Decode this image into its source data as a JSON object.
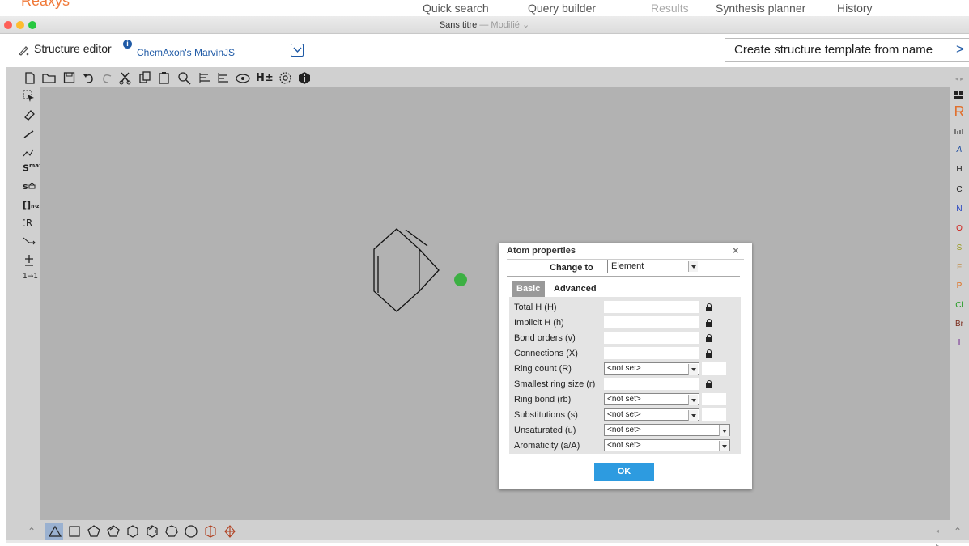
{
  "app": {
    "brand": "Reaxys",
    "nav": [
      "Quick search",
      "Query builder",
      "Results",
      "Synthesis planner",
      "History"
    ]
  },
  "window": {
    "title": "Sans titre",
    "separator": " — ",
    "status": "Modifié"
  },
  "editor_header": {
    "label": "Structure editor",
    "info_icon": "i",
    "engine": "ChemAxon's MarvinJS",
    "template_button": "Create structure template from name",
    "template_chevron": ">"
  },
  "toolbar": {
    "top_text": [
      "H±"
    ],
    "left_labels": [
      "S",
      "max",
      "[]",
      "n-z",
      "R",
      "1→1"
    ],
    "bottom_text": [
      "⌃"
    ]
  },
  "periodic_bar": [
    "R",
    "A",
    "H",
    "C",
    "N",
    "O",
    "S",
    "F",
    "P",
    "Cl",
    "Br",
    "I"
  ],
  "colors": {
    "brand": "#f07a3a",
    "link": "#1f5aa6",
    "ok_button": "#2d9be0",
    "selected_atom": "#3cb043",
    "canvas": "#b2b2b2"
  },
  "dialog": {
    "title": "Atom properties",
    "close": "×",
    "change_to_label": "Change to",
    "change_to_value": "Element",
    "tabs": [
      "Basic",
      "Advanced"
    ],
    "rows": [
      {
        "label": "Total H (H)",
        "kind": "input",
        "lock": true
      },
      {
        "label": "Implicit H (h)",
        "kind": "input",
        "lock": true
      },
      {
        "label": "Bond orders (v)",
        "kind": "input",
        "lock": true
      },
      {
        "label": "Connections (X)",
        "kind": "input",
        "lock": true
      },
      {
        "label": "Ring count (R)",
        "kind": "select",
        "value": "<not set>",
        "extra": true
      },
      {
        "label": "Smallest ring size (r)",
        "kind": "input",
        "lock": true
      },
      {
        "label": "Ring bond (rb)",
        "kind": "select",
        "value": "<not set>",
        "extra": true
      },
      {
        "label": "Substitutions (s)",
        "kind": "select",
        "value": "<not set>",
        "extra": true
      },
      {
        "label": "Unsaturated (u)",
        "kind": "select-wide",
        "value": "<not set>"
      },
      {
        "label": "Aromaticity (a/A)",
        "kind": "select-wide",
        "value": "<not set>"
      }
    ],
    "ok": "OK"
  }
}
